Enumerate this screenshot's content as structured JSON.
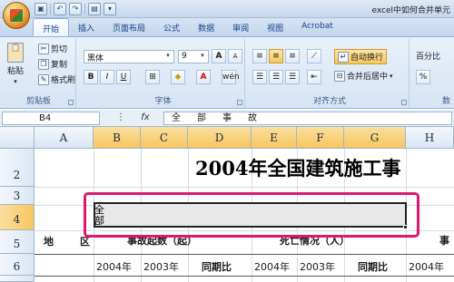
{
  "titlebar": {
    "window_title": "excel中如何合并单元",
    "qat": [
      "save",
      "undo",
      "redo",
      "preview"
    ]
  },
  "tabs": [
    "开始",
    "插入",
    "页面布局",
    "公式",
    "数据",
    "审阅",
    "视图",
    "Acrobat"
  ],
  "active_tab": "开始",
  "ribbon": {
    "clipboard": {
      "paste": "粘贴",
      "cut": "剪切",
      "copy": "复制",
      "format_painter": "格式刷",
      "label": "剪贴板"
    },
    "font": {
      "font_name": "黑体",
      "font_size": "9",
      "bold": "B",
      "italic": "I",
      "underline": "U",
      "grow": "A",
      "shrink": "A",
      "font_color_letter": "A",
      "label": "字体"
    },
    "alignment": {
      "wrap_text": "自动换行",
      "merge_center": "合并后居中",
      "label": "对齐方式"
    },
    "number": {
      "format": "百分比",
      "label": "数"
    }
  },
  "formula_bar": {
    "name_box": "B4",
    "fx": "fx",
    "content": "全部事故"
  },
  "columns": [
    "A",
    "B",
    "C",
    "D",
    "E",
    "F",
    "G",
    "H"
  ],
  "rows": [
    "2",
    "3",
    "4",
    "5",
    "6"
  ],
  "sheet": {
    "title": "2004年全国建筑施工事",
    "b4_text": "全部",
    "region_label": "地",
    "region_label2": "区",
    "group1": "事故起数（起）",
    "group2": "死亡情况（人）",
    "group3": "事",
    "sub_2004": "2004年",
    "sub_2003": "2003年",
    "sub_compare": "同期比",
    "sub_2004b": "2004年",
    "sub_2003b": "2003年",
    "sub_compareb": "同期比",
    "sub_2004c": "2004年"
  },
  "colors": {
    "highlight": "#e0166f",
    "selected_header": "#f7c65d",
    "ribbon_bg": "#d6e4f4"
  }
}
